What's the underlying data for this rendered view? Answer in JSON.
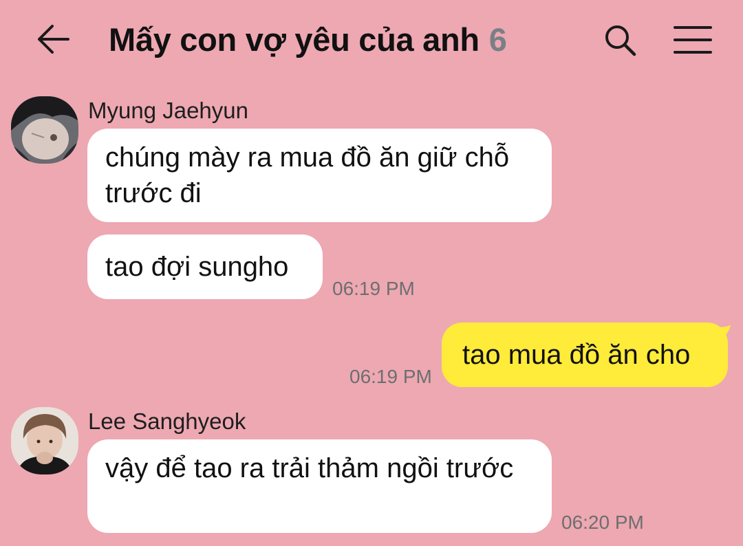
{
  "header": {
    "title": "Mấy con vợ yêu của anh",
    "member_count": "6",
    "back_icon": "arrow-left-icon",
    "search_icon": "search-icon",
    "menu_icon": "hamburger-menu-icon"
  },
  "colors": {
    "background": "#EDA8B2",
    "incoming_bubble": "#FFFFFF",
    "outgoing_bubble": "#FEEB3A"
  },
  "messages": [
    {
      "sender": "Myung Jaehyun",
      "text": "chúng mày ra mua đồ ăn giữ chỗ trước đi"
    },
    {
      "sender": "Myung Jaehyun",
      "text": "tao đợi sungho",
      "time": "06:19 PM"
    },
    {
      "sender": "me",
      "text": "tao mua đồ ăn cho",
      "time": "06:19 PM"
    },
    {
      "sender": "Lee Sanghyeok",
      "text": "vậy để tao ra trải thảm ngồi trước",
      "time": "06:20 PM"
    }
  ]
}
